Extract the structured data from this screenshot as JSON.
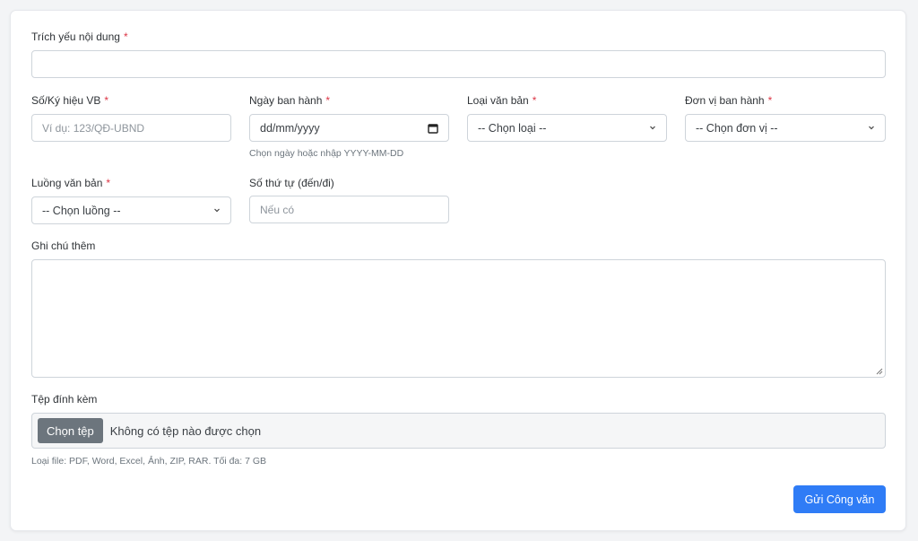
{
  "form": {
    "summary": {
      "label": "Trích yếu nội dung",
      "required": "*",
      "value": ""
    },
    "doc_number": {
      "label": "Số/Ký hiệu VB",
      "required": "*",
      "placeholder": "Ví dụ: 123/QĐ-UBND"
    },
    "issue_date": {
      "label": "Ngày ban hành",
      "required": "*",
      "placeholder": "dd/mm/yyyy",
      "help": "Chọn ngày hoặc nhập YYYY-MM-DD"
    },
    "doc_type": {
      "label": "Loại văn bản",
      "required": "*",
      "selected": "-- Chọn loại --"
    },
    "issuer": {
      "label": "Đơn vị ban hành",
      "required": "*",
      "selected": "-- Chọn đơn vị --"
    },
    "flow": {
      "label": "Luồng văn bản",
      "required": "*",
      "selected": "-- Chọn luồng --"
    },
    "sequence": {
      "label": "Số thứ tự (đến/đi)",
      "placeholder": "Nếu có"
    },
    "notes": {
      "label": "Ghi chú thêm",
      "value": ""
    },
    "attachment": {
      "label": "Tệp đính kèm",
      "button": "Chọn tệp",
      "status": "Không có tệp nào được chọn",
      "help": "Loại file: PDF, Word, Excel, Ảnh, ZIP, RAR. Tối đa: 7 GB"
    },
    "submit_label": "Gửi Công văn"
  },
  "colors": {
    "primary": "#2f7cf6",
    "required": "#dc3545",
    "file_button": "#6c757d"
  },
  "icons": {
    "date": "calendar-icon",
    "select": "chevron-down-icon",
    "textarea": "resize-handle-icon"
  }
}
